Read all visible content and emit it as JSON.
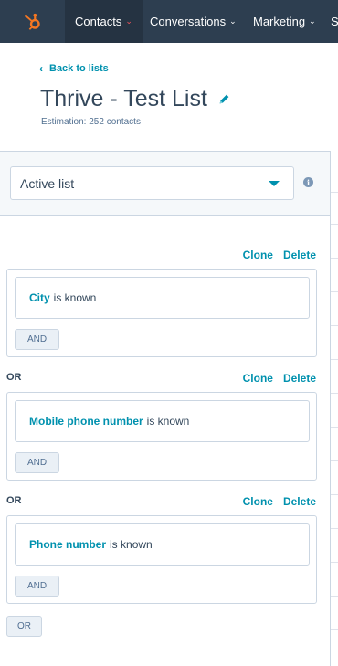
{
  "nav": {
    "items": [
      {
        "label": "Contacts",
        "active": true
      },
      {
        "label": "Conversations",
        "active": false
      },
      {
        "label": "Marketing",
        "active": false
      }
    ],
    "overflow_letter": "S",
    "accent_color": "#f2545b",
    "bg_color": "#2d3e50"
  },
  "header": {
    "back_label": "Back to lists",
    "title": "Thrive - Test List",
    "estimation": "Estimation: 252 contacts"
  },
  "filter_panel": {
    "list_type": "Active list",
    "clone_label": "Clone",
    "delete_label": "Delete",
    "or_label": "OR",
    "and_label": "AND",
    "add_or_label": "OR",
    "groups": [
      {
        "property": "City",
        "condition": "is known"
      },
      {
        "property": "Mobile phone number",
        "condition": "is known"
      },
      {
        "property": "Phone number",
        "condition": "is known"
      }
    ]
  },
  "colors": {
    "link": "#0091ae",
    "text": "#33475b",
    "border": "#cbd6e2"
  }
}
